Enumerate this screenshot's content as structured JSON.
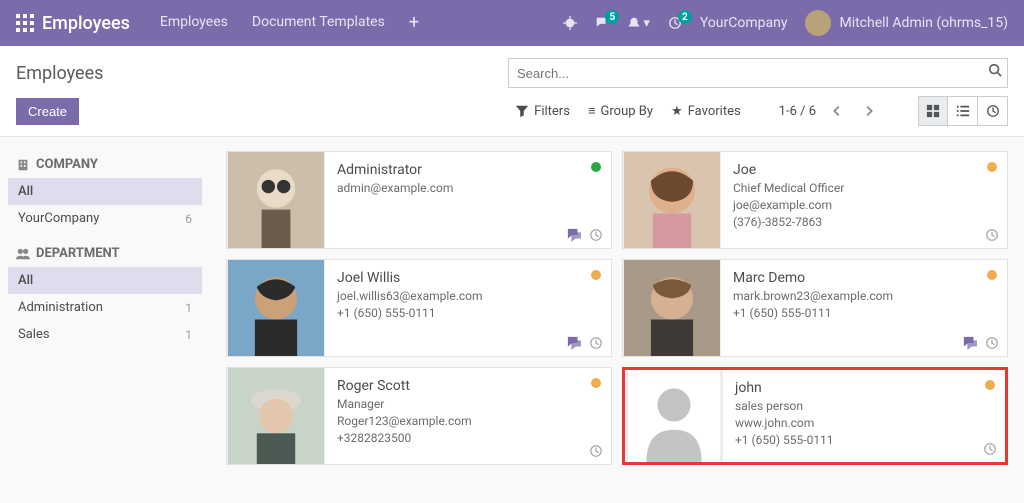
{
  "navbar": {
    "app_name": "Employees",
    "menu": {
      "employees": "Employees",
      "document_templates": "Document Templates"
    },
    "messaging_badge": "5",
    "activity_badge": "2",
    "company": "YourCompany",
    "user": "Mitchell Admin (ohrms_15)"
  },
  "control": {
    "breadcrumb": "Employees",
    "search_placeholder": "Search...",
    "create_label": "Create",
    "filters_label": "Filters",
    "groupby_label": "Group By",
    "favorites_label": "Favorites",
    "pager_text": "1-6 / 6"
  },
  "sidebar": {
    "company_heading": "COMPANY",
    "company_all": "All",
    "company_items": [
      {
        "label": "YourCompany",
        "count": "6"
      }
    ],
    "dept_heading": "DEPARTMENT",
    "dept_all": "All",
    "dept_items": [
      {
        "label": "Administration",
        "count": "1"
      },
      {
        "label": "Sales",
        "count": "1"
      }
    ]
  },
  "employees": [
    {
      "name": "Administrator",
      "title": "",
      "email": "admin@example.com",
      "phone": "",
      "status": "green",
      "has_msg": true,
      "photo": "photo1",
      "highlight": false
    },
    {
      "name": "Joe",
      "title": "Chief Medical Officer",
      "email": "joe@example.com",
      "phone": "(376)-3852-7863",
      "status": "orange",
      "has_msg": false,
      "photo": "photo2",
      "highlight": false
    },
    {
      "name": "Joel Willis",
      "title": "",
      "email": "joel.willis63@example.com",
      "phone": "+1 (650) 555-0111",
      "status": "orange",
      "has_msg": true,
      "photo": "photo3",
      "highlight": false
    },
    {
      "name": "Marc Demo",
      "title": "",
      "email": "mark.brown23@example.com",
      "phone": "+1 (650) 555-0111",
      "status": "orange",
      "has_msg": true,
      "photo": "photo4",
      "highlight": false
    },
    {
      "name": "Roger Scott",
      "title": "Manager",
      "email": "Roger123@example.com",
      "phone": "+3282823500",
      "status": "orange",
      "has_msg": false,
      "photo": "photo5",
      "highlight": false
    },
    {
      "name": "john",
      "title": "sales person",
      "email": "www.john.com",
      "phone": "+1 (650) 555-0111",
      "status": "orange",
      "has_msg": false,
      "photo": "placeholder",
      "highlight": true
    }
  ]
}
